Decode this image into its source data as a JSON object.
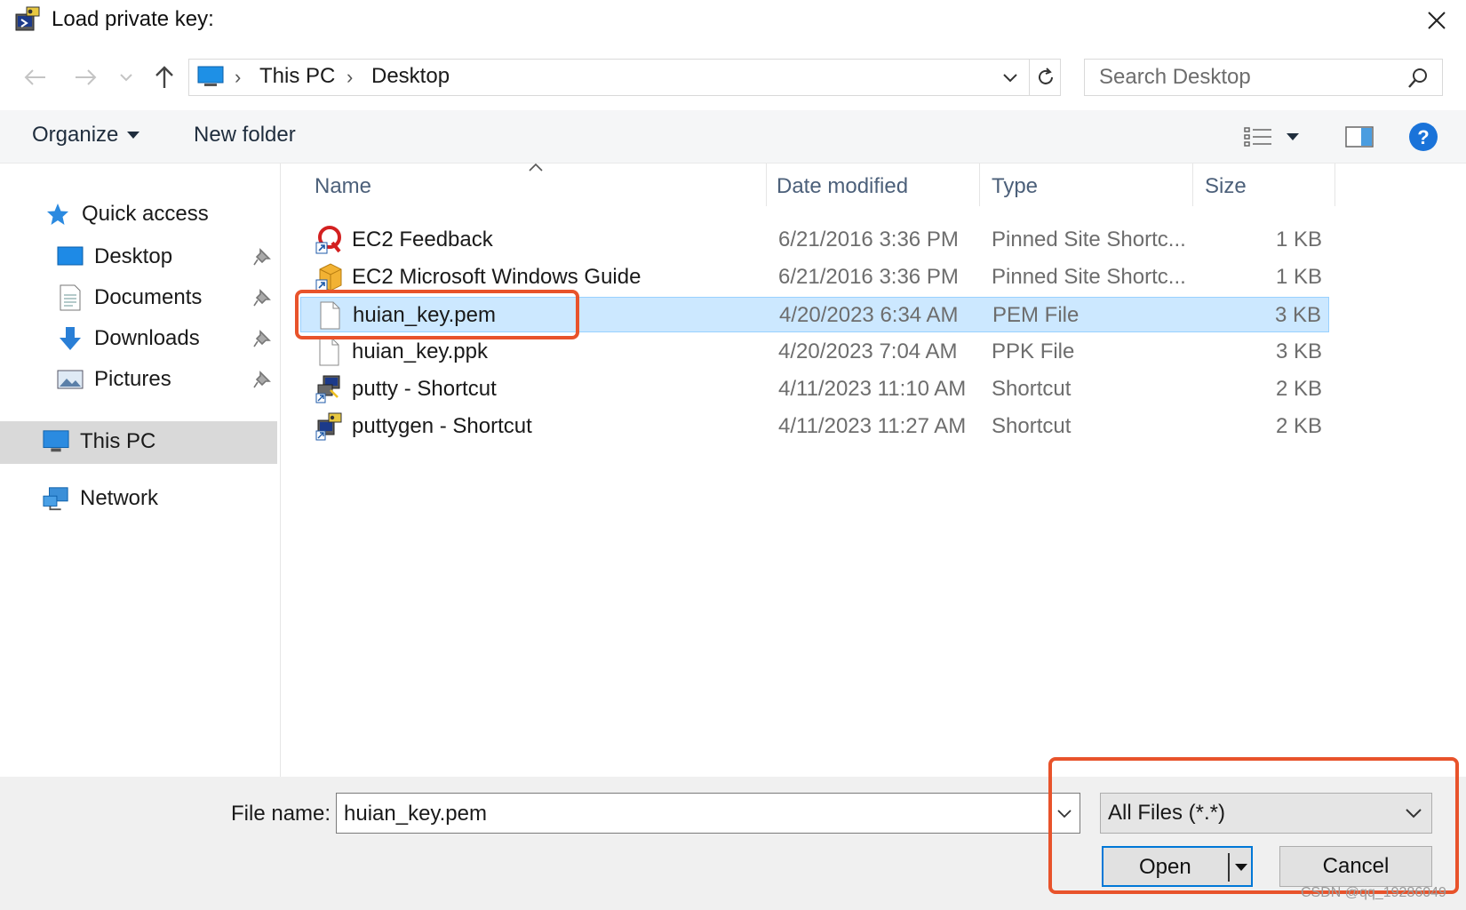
{
  "window": {
    "title": "Load private key:",
    "close_icon": "close-icon"
  },
  "address": {
    "crumbs": [
      "This PC",
      "Desktop"
    ],
    "search_placeholder": "Search Desktop"
  },
  "toolbar": {
    "organize_label": "Organize",
    "new_folder_label": "New folder"
  },
  "nav": {
    "quick_access": "Quick access",
    "items": [
      {
        "label": "Desktop",
        "icon": "desktop-icon",
        "pinned": true
      },
      {
        "label": "Documents",
        "icon": "documents-icon",
        "pinned": true
      },
      {
        "label": "Downloads",
        "icon": "downloads-icon",
        "pinned": true
      },
      {
        "label": "Pictures",
        "icon": "pictures-icon",
        "pinned": true
      }
    ],
    "this_pc": "This PC",
    "network": "Network"
  },
  "files": {
    "columns": [
      "Name",
      "Date modified",
      "Type",
      "Size"
    ],
    "rows": [
      {
        "name": "EC2 Feedback",
        "date": "6/21/2016 3:36 PM",
        "type": "Pinned Site Shortc...",
        "size": "1 KB",
        "icon": "feedback-shortcut-icon"
      },
      {
        "name": "EC2 Microsoft Windows Guide",
        "date": "6/21/2016 3:36 PM",
        "type": "Pinned Site Shortc...",
        "size": "1 KB",
        "icon": "guide-shortcut-icon"
      },
      {
        "name": "huian_key.pem",
        "date": "4/20/2023 6:34 AM",
        "type": "PEM File",
        "size": "3 KB",
        "icon": "file-icon",
        "selected": true
      },
      {
        "name": "huian_key.ppk",
        "date": "4/20/2023 7:04 AM",
        "type": "PPK File",
        "size": "3 KB",
        "icon": "file-icon"
      },
      {
        "name": "putty - Shortcut",
        "date": "4/11/2023 11:10 AM",
        "type": "Shortcut",
        "size": "2 KB",
        "icon": "putty-icon"
      },
      {
        "name": "puttygen - Shortcut",
        "date": "4/11/2023 11:27 AM",
        "type": "Shortcut",
        "size": "2 KB",
        "icon": "puttygen-icon"
      }
    ]
  },
  "bottom": {
    "file_name_label": "File name:",
    "file_name_value": "huian_key.pem",
    "filter_value": "All Files (*.*)",
    "open_label": "Open",
    "cancel_label": "Cancel"
  },
  "watermark": "CSDN @qq_19286049",
  "colors": {
    "annotation": "#e8532b",
    "selection_bg": "#cce8ff",
    "accent": "#0078d7"
  }
}
